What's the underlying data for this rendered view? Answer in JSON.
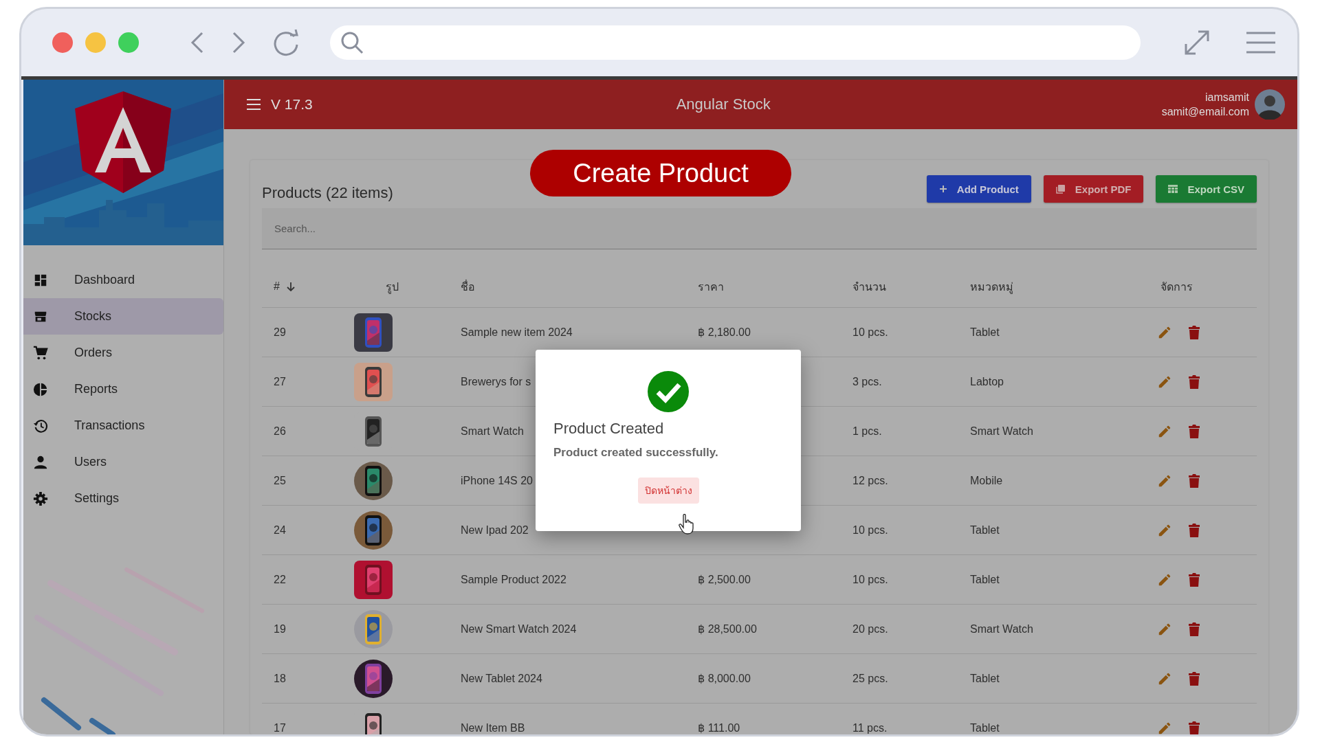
{
  "header": {
    "version": "V 17.3",
    "title": "Angular Stock",
    "user": {
      "name": "iamsamit",
      "email": "samit@email.com"
    }
  },
  "sidebar": {
    "items": [
      {
        "label": "Dashboard",
        "selected": false
      },
      {
        "label": "Stocks",
        "selected": true
      },
      {
        "label": "Orders",
        "selected": false
      },
      {
        "label": "Reports",
        "selected": false
      },
      {
        "label": "Transactions",
        "selected": false
      },
      {
        "label": "Users",
        "selected": false
      },
      {
        "label": "Settings",
        "selected": false
      }
    ]
  },
  "banner": "Create Product",
  "card": {
    "title": "Products (22 items)",
    "buttons": [
      {
        "label": "Add Product",
        "kind": "add"
      },
      {
        "label": "Export PDF",
        "kind": "pdf"
      },
      {
        "label": "Export CSV",
        "kind": "csv"
      }
    ],
    "search": {
      "placeholder": "Search..."
    },
    "table": {
      "columns": [
        {
          "label": "#",
          "sorted": true
        },
        {
          "label": "รูป",
          "sorted": false
        },
        {
          "label": "ชื่อ",
          "sorted": false
        },
        {
          "label": "ราคา",
          "sorted": false
        },
        {
          "label": "จำนวน",
          "sorted": false
        },
        {
          "label": "หมวดหมู่",
          "sorted": false
        },
        {
          "label": "จัดการ",
          "sorted": false
        }
      ],
      "rows": [
        {
          "id": "29",
          "name": "Sample new item 2024",
          "price": "฿ 2,180.00",
          "quantity": "10 pcs.",
          "category": "Tablet"
        },
        {
          "id": "27",
          "name": "Brewerys for s",
          "quantity": "3 pcs.",
          "category": "Labtop"
        },
        {
          "id": "26",
          "name": "Smart Watch",
          "quantity": "1 pcs.",
          "category": "Smart Watch"
        },
        {
          "id": "25",
          "name": "iPhone 14S 20",
          "quantity": "12 pcs.",
          "category": "Mobile"
        },
        {
          "id": "24",
          "name": "New Ipad 202",
          "quantity": "10 pcs.",
          "category": "Tablet"
        },
        {
          "id": "22",
          "name": "Sample Product 2022",
          "price": "฿ 2,500.00",
          "quantity": "10 pcs.",
          "category": "Tablet"
        },
        {
          "id": "19",
          "name": "New Smart Watch 2024",
          "price": "฿ 28,500.00",
          "quantity": "20 pcs.",
          "category": "Smart Watch"
        },
        {
          "id": "18",
          "name": "New Tablet 2024",
          "price": "฿ 8,000.00",
          "quantity": "25 pcs.",
          "category": "Tablet"
        },
        {
          "id": "17",
          "name": "New Item BB",
          "price": "฿ 111.00",
          "quantity": "11 pcs.",
          "category": "Tablet"
        }
      ]
    }
  },
  "dialog": {
    "title": "Product Created",
    "message": "Product created successfully.",
    "button": "ปิดหน้าต่าง"
  }
}
